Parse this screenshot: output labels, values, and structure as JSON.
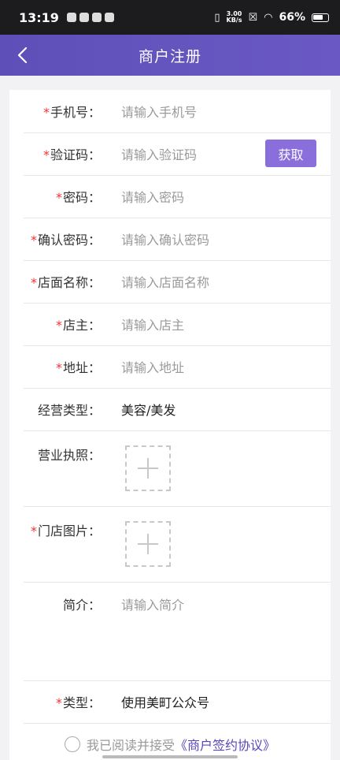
{
  "status": {
    "time": "13:19",
    "speed_value": "3.00",
    "speed_unit": "KB/s",
    "battery": "66%"
  },
  "nav": {
    "title": "商户注册"
  },
  "form": {
    "phone": {
      "label": "手机号：",
      "placeholder": "请输入手机号",
      "required": true
    },
    "code": {
      "label": "验证码：",
      "placeholder": "请输入验证码",
      "required": true,
      "button": "获取"
    },
    "password": {
      "label": "密码：",
      "placeholder": "请输入密码",
      "required": true
    },
    "confirm": {
      "label": "确认密码：",
      "placeholder": "请输入确认密码",
      "required": true
    },
    "shop_name": {
      "label": "店面名称：",
      "placeholder": "请输入店面名称",
      "required": true
    },
    "owner": {
      "label": "店主：",
      "placeholder": "请输入店主",
      "required": true
    },
    "address": {
      "label": "地址：",
      "placeholder": "请输入地址",
      "required": true
    },
    "business_type": {
      "label": "经营类型：",
      "value": "美容/美发"
    },
    "license": {
      "label": "营业执照："
    },
    "shop_photo": {
      "label": "门店图片：",
      "required": true
    },
    "intro": {
      "label": "简介：",
      "placeholder": "请输入简介"
    },
    "type": {
      "label": "类型：",
      "value": "使用美町公众号",
      "required": true
    }
  },
  "agreement": {
    "text": "我已阅读并接受",
    "link": "《商户签约协议》"
  },
  "required_mark": "*"
}
